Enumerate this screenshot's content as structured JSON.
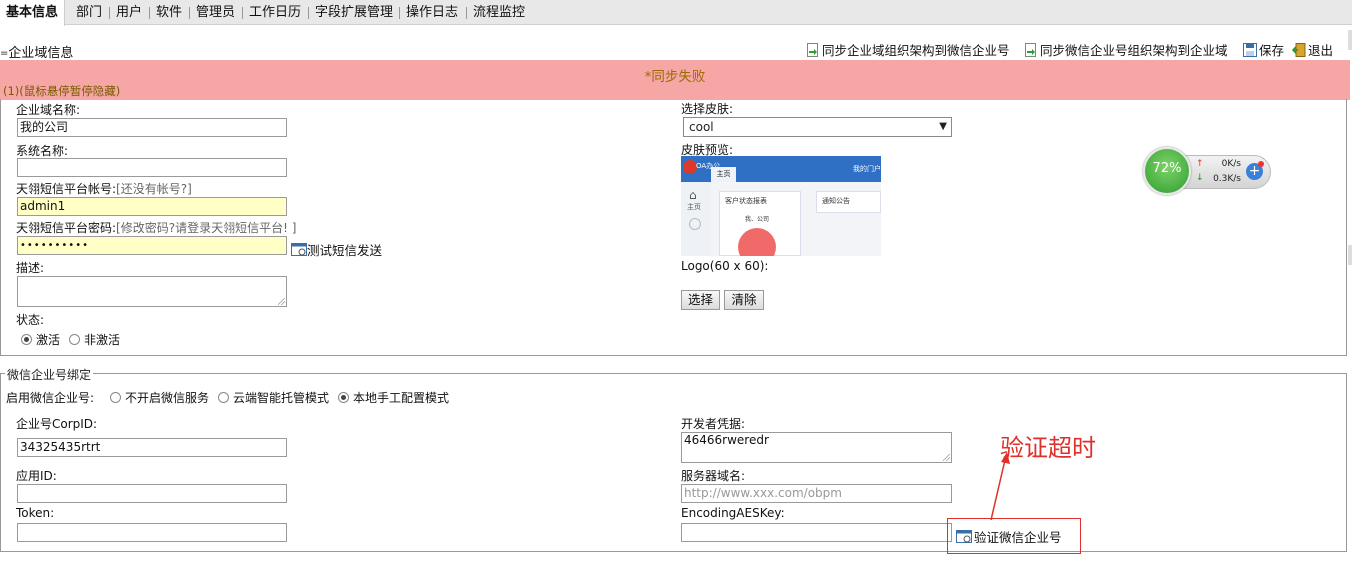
{
  "tabs": [
    {
      "label": "基本信息",
      "active": true
    },
    {
      "label": "部门"
    },
    {
      "label": "用户"
    },
    {
      "label": "软件"
    },
    {
      "label": "管理员"
    },
    {
      "label": "工作日历"
    },
    {
      "label": "字段扩展管理"
    },
    {
      "label": "操作日志"
    },
    {
      "label": "流程监控"
    }
  ],
  "section": {
    "title": "企业域信息",
    "collapse_glyph": "="
  },
  "toolbar": {
    "sync_to_wechat": "同步企业域组织架构到微信企业号",
    "sync_from_wechat": "同步微信企业号组织架构到企业域",
    "save": "保存",
    "exit": "退出"
  },
  "banner": {
    "message": "*同步失败",
    "hint": "(1)(鼠标悬停暂停隐藏)",
    "color": "#f7a6a6"
  },
  "form": {
    "domain_name_label": "企业域名称:",
    "domain_name_value": "我的公司",
    "system_name_label": "系统名称:",
    "system_name_value": "",
    "sms_account_label": "天翎短信平台帐号:",
    "sms_account_link": "[还没有帐号?]",
    "sms_account_value": "admin1",
    "sms_password_label": "天翎短信平台密码:",
    "sms_password_link": "[修改密码?请登录天翎短信平台! ]",
    "sms_password_value": "••••••••••",
    "sms_test": "测试短信发送",
    "desc_label": "描述:",
    "desc_value": "",
    "status_label": "状态:",
    "status_active": "激活",
    "status_inactive": "非激活",
    "skin_label": "选择皮肤:",
    "skin_value": "cool",
    "skin_preview_label": "皮肤预览:",
    "logo_label": "Logo(60 x 60):",
    "logo_choose": "选择",
    "logo_clear": "清除"
  },
  "skin_preview": {
    "brand": "OA办公",
    "tab": "主页",
    "right_link": "我的门户",
    "side_item": "主页",
    "panel1": "客户状态报表",
    "panel1_sub": "我、公司",
    "panel2": "通知公告"
  },
  "network_widget": {
    "percent": "72%",
    "up": "0K/s",
    "down": "0.3K/s"
  },
  "wechat": {
    "legend": "微信企业号绑定",
    "enable_label": "启用微信企业号:",
    "opt_off": "不开启微信服务",
    "opt_cloud": "云端智能托管模式",
    "opt_local": "本地手工配置模式",
    "corpid_label": "企业号CorpID:",
    "corpid_value": "34325435rtrt",
    "appid_label": "应用ID:",
    "appid_value": "",
    "token_label": "Token:",
    "token_value": "",
    "secret_label": "开发者凭据:",
    "secret_value": "46466rweredr",
    "server_label": "服务器域名:",
    "server_placeholder": "http://www.xxx.com/obpm",
    "aes_label": "EncodingAESKey:",
    "aes_value": "",
    "verify": "验证微信企业号"
  },
  "annotation": {
    "text": "验证超时",
    "color": "#e0302b"
  }
}
